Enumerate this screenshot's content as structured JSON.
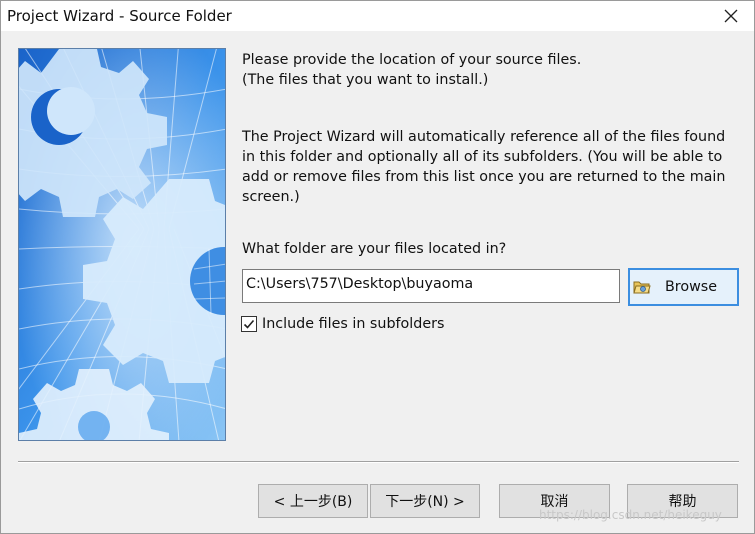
{
  "window": {
    "title": "Project Wizard - Source Folder"
  },
  "content": {
    "intro_line1": "Please provide the location of your source files.",
    "intro_line2": "(The files that you want to install.)",
    "desc_line1": "The Project Wizard will automatically reference all of the files found",
    "desc_line2": "in this folder and optionally all of its subfolders. (You will be able to",
    "desc_line3": "add or remove files from this list once you are returned to the main",
    "desc_line4": "screen.)",
    "folder_question": "What folder are your files located in?",
    "folder_path": "C:\\Users\\757\\Desktop\\buyaoma",
    "browse_label": "Browse",
    "include_subfolders_label": "Include files in subfolders",
    "include_subfolders_checked": true
  },
  "buttons": {
    "back": "< 上一步(B)",
    "next": "下一步(N) >",
    "cancel": "取消",
    "help": "帮助"
  },
  "watermark": "https://blog.csdn.net/heikeguy",
  "icons": {
    "close": "close-icon",
    "browse": "folder-icon",
    "checkbox": "checkmark-icon"
  },
  "colors": {
    "accent": "#3c8ee0",
    "dialog_bg": "#f0f0f0",
    "banner_blue": "#2f84e0"
  }
}
